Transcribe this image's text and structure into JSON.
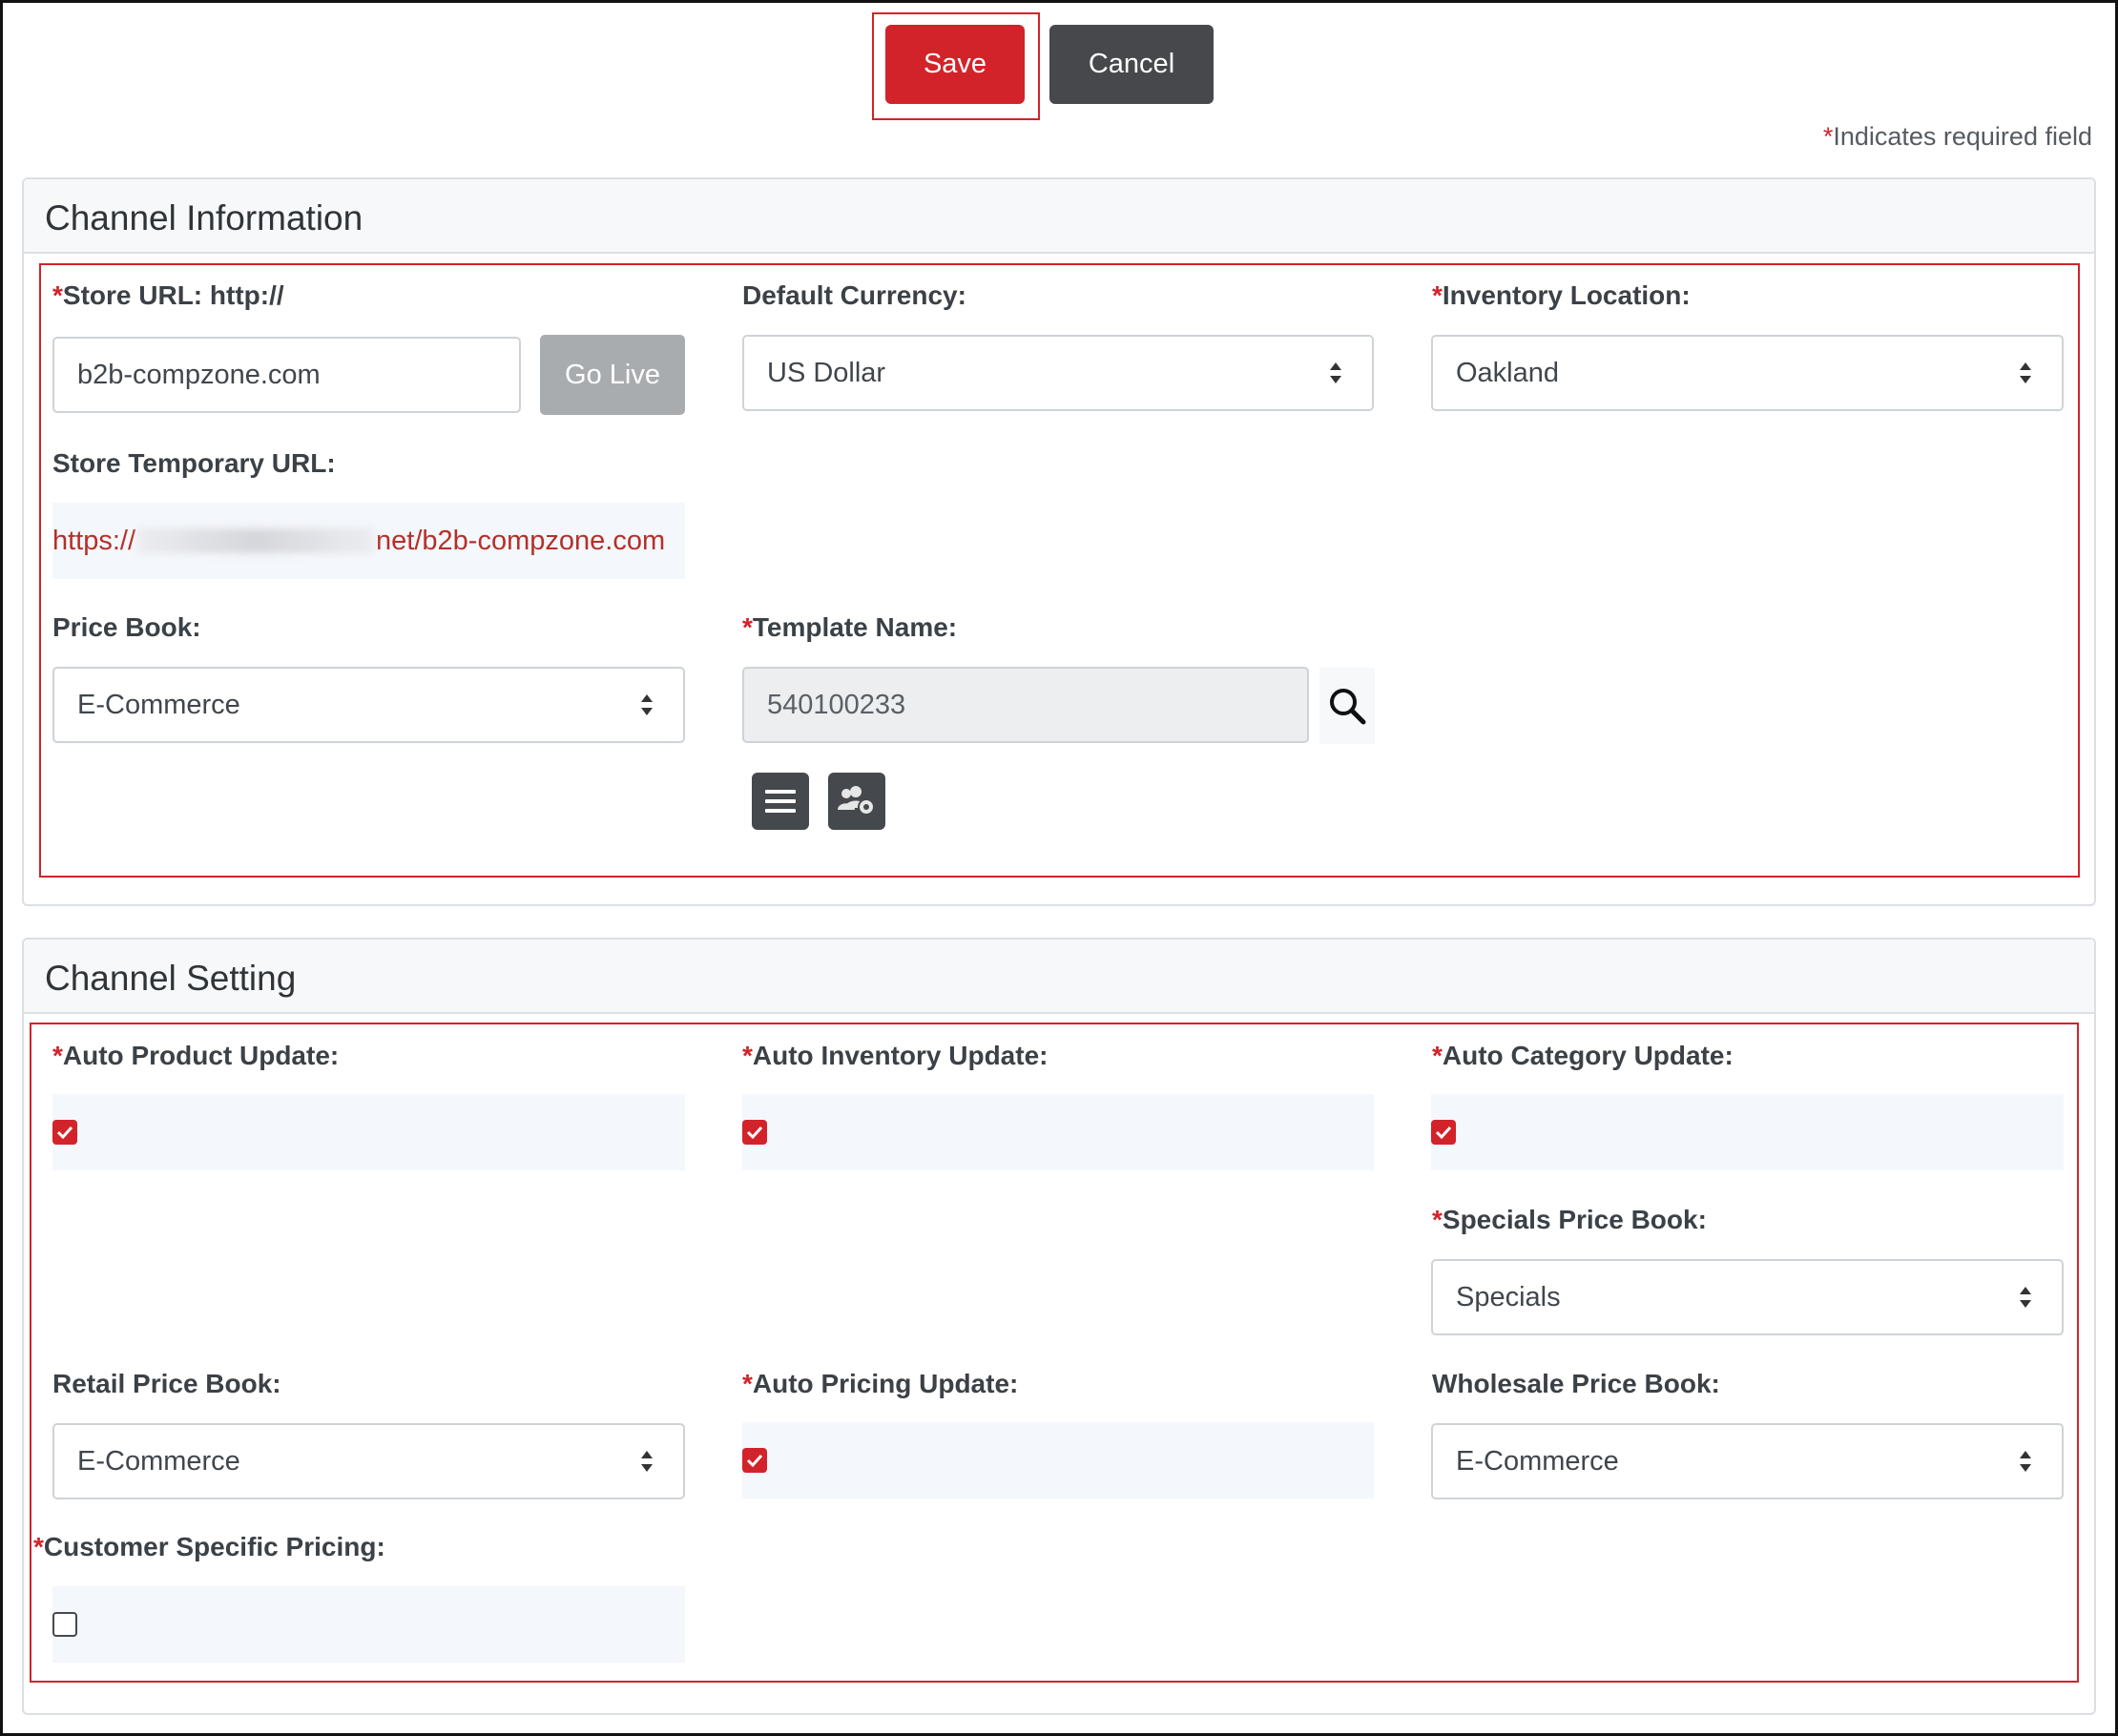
{
  "toolbar": {
    "save_label": "Save",
    "cancel_label": "Cancel",
    "required_star": "*",
    "required_note": "Indicates required field"
  },
  "channel_info": {
    "title": "Channel Information",
    "store_url": {
      "star": "*",
      "label": "Store URL: http://",
      "value": "b2b-compzone.com",
      "go_live": "Go Live"
    },
    "default_currency": {
      "label": "Default Currency:",
      "value": "US Dollar"
    },
    "inventory_location": {
      "star": "*",
      "label": "Inventory Location:",
      "value": "Oakland"
    },
    "store_temp_url": {
      "label": "Store Temporary URL:",
      "prefix": "https://",
      "suffix": "net/b2b-compzone.com"
    },
    "price_book": {
      "label": "Price Book:",
      "value": "E-Commerce"
    },
    "template_name": {
      "star": "*",
      "label": "Template Name:",
      "value": "540100233"
    }
  },
  "channel_setting": {
    "title": "Channel Setting",
    "auto_product_update": {
      "star": "*",
      "label": "Auto Product Update:",
      "checked": true
    },
    "auto_inventory_update": {
      "star": "*",
      "label": "Auto Inventory Update:",
      "checked": true
    },
    "auto_category_update": {
      "star": "*",
      "label": "Auto Category Update:",
      "checked": true
    },
    "specials_price_book": {
      "star": "*",
      "label": "Specials Price Book:",
      "value": "Specials"
    },
    "retail_price_book": {
      "label": "Retail Price Book:",
      "value": "E-Commerce"
    },
    "auto_pricing_update": {
      "star": "*",
      "label": "Auto Pricing Update:",
      "checked": true
    },
    "wholesale_price_book": {
      "label": "Wholesale Price Book:",
      "value": "E-Commerce"
    },
    "customer_specific_pricing": {
      "star": "*",
      "label": "Customer Specific Pricing:",
      "checked": false
    }
  },
  "colors": {
    "accent_red": "#d2232a",
    "dark_button": "#46484c",
    "disabled_button": "#a9acaf",
    "link_red": "#b5302a"
  }
}
